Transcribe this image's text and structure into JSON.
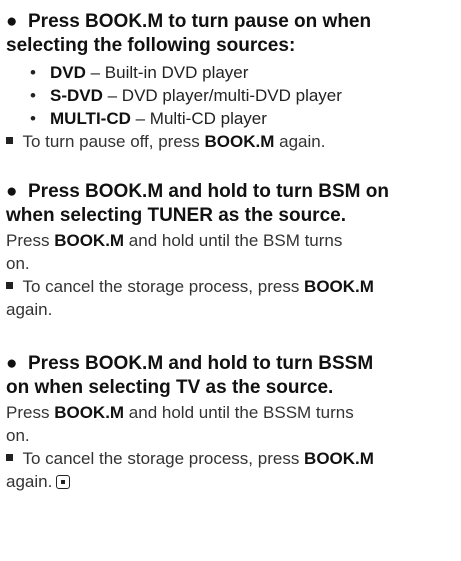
{
  "section1": {
    "heading_line1": "Press BOOK.M to turn pause on when",
    "heading_line2": "selecting the following sources:",
    "items": [
      {
        "name": "DVD",
        "desc": " – Built-in DVD player"
      },
      {
        "name": "S-DVD",
        "desc": " – DVD player/multi-DVD player"
      },
      {
        "name": "MULTI-CD",
        "desc": " – Multi-CD player"
      }
    ],
    "note_pre": "To turn pause off, press ",
    "note_bold": "BOOK.M",
    "note_post": " again."
  },
  "section2": {
    "heading_line1": "Press BOOK.M and hold to turn BSM on",
    "heading_line2": "when selecting TUNER as the source.",
    "body_pre": "Press ",
    "body_bold": "BOOK.M",
    "body_line1_post": " and hold until the BSM turns",
    "body_line2": "on.",
    "note_line1_pre": "To cancel the storage process, press ",
    "note_bold": "BOOK.M",
    "note_line2": "again."
  },
  "section3": {
    "heading_line1": "Press BOOK.M and hold to turn BSSM",
    "heading_line2": "on when selecting TV as the source.",
    "body_pre": "Press ",
    "body_bold": "BOOK.M",
    "body_line1_post": " and hold until the BSSM turns",
    "body_line2": "on.",
    "note_line1_pre": "To cancel the storage process, press ",
    "note_bold": "BOOK.M",
    "note_line2": "again."
  }
}
